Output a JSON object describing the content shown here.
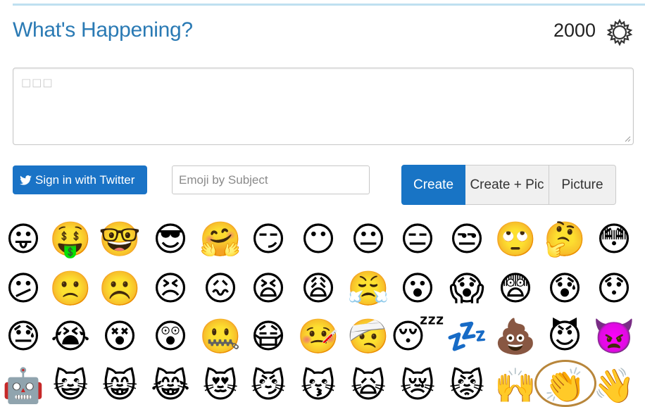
{
  "header": {
    "title": "What's Happening?",
    "char_count": "2000"
  },
  "compose": {
    "placeholder": "□□□"
  },
  "actions": {
    "twitter_label": "Sign in with Twitter",
    "search_placeholder": "Emoji by Subject",
    "create_label": "Create",
    "create_pic_label": "Create + Pic",
    "picture_label": "Picture",
    "active_tab": "Create"
  },
  "colors": {
    "title": "#2a7ab4",
    "primary": "#1874c5",
    "highlight": "#b8863b"
  },
  "emoji_rows": [
    [
      "😛",
      "🤑",
      "🤓",
      "😎",
      "🤗",
      "😏",
      "😶",
      "😐",
      "😑",
      "😒",
      "🙄",
      "🤔",
      "😳"
    ],
    [
      "😕",
      "🙁",
      "☹️",
      "😣",
      "😖",
      "😫",
      "😩",
      "😤",
      "😮",
      "😱",
      "😨",
      "😰",
      "😯"
    ],
    [
      "😓",
      "😭",
      "😵",
      "😲",
      "🤐",
      "😷",
      "🤒",
      "🤕",
      "😴",
      "💤",
      "💩",
      "😈",
      "👿"
    ],
    [
      "🤖",
      "😺",
      "😸",
      "😹",
      "😻",
      "😼",
      "😽",
      "🙀",
      "😿",
      "😾",
      "🙌",
      "👏",
      "👋"
    ]
  ],
  "selected_emoji": "👏"
}
